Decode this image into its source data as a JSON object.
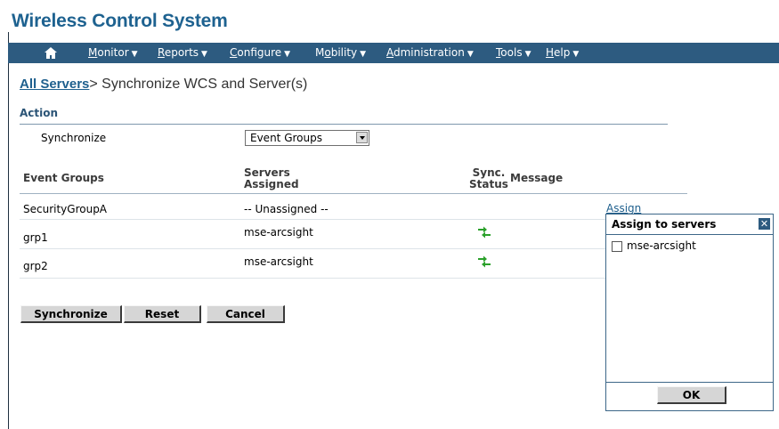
{
  "app": {
    "title": "Wireless Control System"
  },
  "menu": [
    {
      "pre": "",
      "acc": "M",
      "post": "onitor"
    },
    {
      "pre": "",
      "acc": "R",
      "post": "eports"
    },
    {
      "pre": "",
      "acc": "C",
      "post": "onfigure"
    },
    {
      "pre": "M",
      "acc": "o",
      "post": "bility"
    },
    {
      "pre": "",
      "acc": "A",
      "post": "dministration"
    },
    {
      "pre": "",
      "acc": "T",
      "post": "ools"
    },
    {
      "pre": "",
      "acc": "H",
      "post": "elp"
    }
  ],
  "breadcrumb": {
    "link": "All Servers",
    "rest": "> Synchronize WCS and Server(s)"
  },
  "action": {
    "section_title": "Action",
    "label": "Synchronize",
    "selected": "Event Groups"
  },
  "table": {
    "headers": {
      "col1": "Event Groups",
      "col2_line1": "Servers",
      "col2_line2": "Assigned",
      "col3_line1": "Sync.",
      "col3_line2": "Status",
      "col4": "Message"
    },
    "rows": [
      {
        "group": "SecurityGroupA",
        "servers": "-- Unassigned --",
        "status": ""
      },
      {
        "group": "grp1",
        "servers": "mse-arcsight",
        "status": "synced"
      },
      {
        "group": "grp2",
        "servers": "mse-arcsight",
        "status": "synced"
      }
    ],
    "assign_link": "Assign"
  },
  "buttons": {
    "synchronize": "Synchronize",
    "reset": "Reset",
    "cancel": "Cancel"
  },
  "popup": {
    "title": "Assign to servers",
    "option": "mse-arcsight",
    "ok": "OK"
  },
  "colors": {
    "brand_blue": "#1e6290",
    "menubar": "#2d5b80",
    "sync_green": "#2aa02a"
  }
}
